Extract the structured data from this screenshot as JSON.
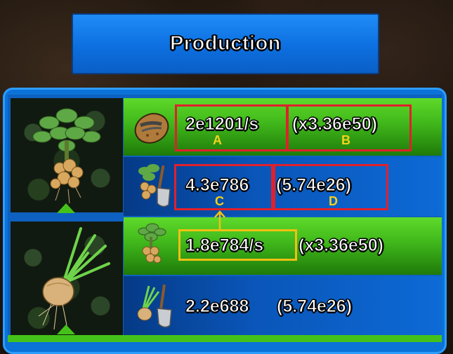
{
  "header": {
    "title": "Production"
  },
  "rows": [
    {
      "id": "potato-production",
      "value": "2e1201/s",
      "multiplier": "(x3.36e50)"
    },
    {
      "id": "potato-farmer",
      "value": "4.3e786",
      "multiplier": "(5.74e26)"
    },
    {
      "id": "onion-production",
      "value": "1.8e784/s",
      "multiplier": "(x3.36e50)"
    },
    {
      "id": "onion-farmer",
      "value": "2.2e688",
      "multiplier": "(5.74e26)"
    }
  ],
  "annotations": {
    "a": "A",
    "b": "B",
    "c": "C",
    "d": "D"
  },
  "icons": {
    "potato_plant": "potato-plant-icon",
    "onion_plant": "onion-plant-icon",
    "potato_item": "potato-item-icon",
    "shovel_potato": "shovel-potato-icon",
    "shovel_onion": "shovel-onion-icon"
  },
  "colors": {
    "row_green": "#45c21a",
    "row_blue": "#0b62c9",
    "highlight_red": "#e0202c",
    "highlight_yellow": "#f2c012",
    "label_yellow": "#f4d11a"
  }
}
